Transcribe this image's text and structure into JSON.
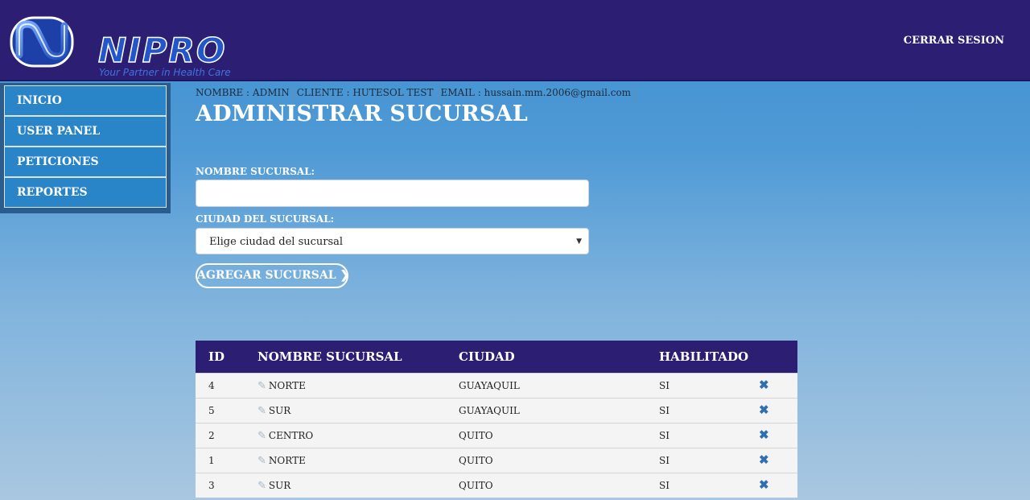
{
  "header": {
    "logo_text": "NIPRO",
    "logo_tagline": "Your Partner in Health Care",
    "logout_label": "CERRAR SESION"
  },
  "sidebar": {
    "items": [
      {
        "label": "INICIO"
      },
      {
        "label": "USER PANEL"
      },
      {
        "label": "PETICIONES"
      },
      {
        "label": "REPORTES"
      }
    ]
  },
  "userinfo": {
    "nombre": "NOMBRE : ADMIN",
    "cliente": "CLIENTE : HUTESOL TEST",
    "email": "EMAIL : hussain.mm.2006@gmail.com"
  },
  "page": {
    "title": "ADMINISTRAR SUCURSAL"
  },
  "form": {
    "name_label": "NOMBRE SUCURSAL:",
    "name_value": "",
    "city_label": "CIUDAD DEL SUCURSAL:",
    "city_selected": "Elige ciudad del sucursal",
    "add_button": "AGREGAR SUCURSAL"
  },
  "table": {
    "headers": [
      "ID",
      "NOMBRE SUCURSAL",
      "CIUDAD",
      "HABILITADO"
    ],
    "rows": [
      {
        "id": "4",
        "name": "NORTE",
        "city": "GUAYAQUIL",
        "enabled": "SI"
      },
      {
        "id": "5",
        "name": "SUR",
        "city": "GUAYAQUIL",
        "enabled": "SI"
      },
      {
        "id": "2",
        "name": "CENTRO",
        "city": "QUITO",
        "enabled": "SI"
      },
      {
        "id": "1",
        "name": "NORTE",
        "city": "QUITO",
        "enabled": "SI"
      },
      {
        "id": "3",
        "name": "SUR",
        "city": "QUITO",
        "enabled": "SI"
      }
    ]
  },
  "icons": {
    "edit": "pencil-icon",
    "delete": "close-icon",
    "button_arrow": "chevron-right-icon"
  },
  "colors": {
    "header_bg": "#2c1e72",
    "sidebar_item_bg": "#2a84c8",
    "delete_icon": "#2f6fb0"
  }
}
